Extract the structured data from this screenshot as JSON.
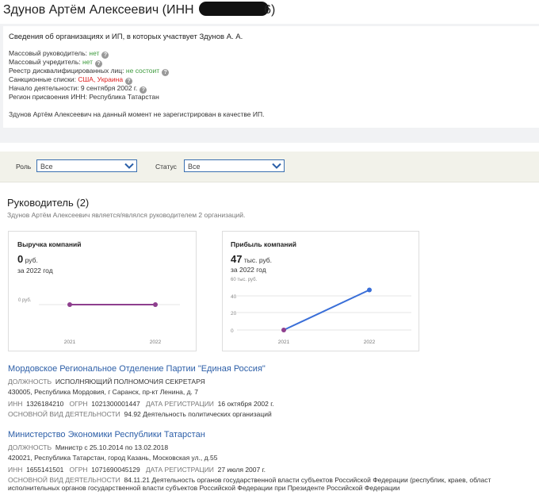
{
  "header": {
    "title_prefix": "Здунов Артём Алексеевич (ИНН ",
    "title_suffix": "6)"
  },
  "summary": {
    "intro": "Сведения об организациях и ИП, в которых участвует Здунов А. А.",
    "rows": [
      {
        "label": "Массовый руководитель:",
        "value": "нет",
        "value_color": "#3d9a3d"
      },
      {
        "label": "Массовый учредитель:",
        "value": "нет",
        "value_color": "#3d9a3d"
      },
      {
        "label": "Реестр дисквалифицированных лиц:",
        "value": "не состоит",
        "value_color": "#3d9a3d"
      },
      {
        "label": "Санкционные списки:",
        "value": "США, Украина",
        "value_color": "#dd2222"
      }
    ],
    "start_activity": "Начало деятельности: 9 сентября 2002 г.",
    "inn_region": "Регион присвоения ИНН: Республика Татарстан",
    "ip_note": "Здунов Артём Алексеевич на данный момент не зарегистрирован в качестве ИП."
  },
  "filters": {
    "role_label": "Роль",
    "role_value": "Все",
    "status_label": "Статус",
    "status_value": "Все"
  },
  "section": {
    "title": "Руководитель (2)",
    "subtitle": "Здунов Артём Алексеевич является/являлся руководителем 2 организаций."
  },
  "charts": {
    "revenue": {
      "title": "Выручка компаний",
      "value": "0",
      "unit": "руб.",
      "period": "за 2022 год"
    },
    "profit": {
      "title": "Прибыль компаний",
      "value": "47",
      "unit": "тыс. руб.",
      "period": "за 2022 год"
    }
  },
  "chart_data": [
    {
      "type": "line",
      "title": "Выручка компаний",
      "x": [
        "2021",
        "2022"
      ],
      "y": [
        0,
        0
      ],
      "ytick_labels": [
        "0 руб."
      ],
      "series_color": "#8e3f8e"
    },
    {
      "type": "line",
      "title": "Прибыль компаний",
      "x": [
        "2021",
        "2022"
      ],
      "y": [
        0,
        47
      ],
      "ylim": [
        0,
        60
      ],
      "yticks": [
        0,
        20,
        40
      ],
      "ytop_label": "60 тыс. руб.",
      "series_color": "#3a6fd8"
    }
  ],
  "orgs": [
    {
      "name": "Мордовское Региональное Отделение Партии \"Единая Россия\"",
      "position_label": "ДОЛЖНОСТЬ",
      "position": "ИСПОЛНЯЮЩИЙ ПОЛНОМОЧИЯ СЕКРЕТАРЯ",
      "address": "430005, Республика Мордовия, г Саранск, пр-кт Ленина, д. 7",
      "inn_label": "ИНН",
      "inn": "1326184210",
      "ogrn_label": "ОГРН",
      "ogrn": "1021300001447",
      "reg_label": "ДАТА РЕГИСТРАЦИИ",
      "reg": "16 октября 2002 г.",
      "activity_label": "ОСНОВНОЙ ВИД ДЕЯТЕЛЬНОСТИ",
      "activity": "94.92 Деятельность политических организаций"
    },
    {
      "name": "Министерство Экономики Республики Татарстан",
      "position_label": "ДОЛЖНОСТЬ",
      "position": "Министр с 25.10.2014 по 13.02.2018",
      "address": "420021, Республика Татарстан, город Казань, Московская ул., д.55",
      "inn_label": "ИНН",
      "inn": "1655141501",
      "ogrn_label": "ОГРН",
      "ogrn": "1071690045129",
      "reg_label": "ДАТА РЕГИСТРАЦИИ",
      "reg": "27 июля 2007 г.",
      "activity_label": "ОСНОВНОЙ ВИД ДЕЯТЕЛЬНОСТИ",
      "activity": "84.11.21 Деятельность органов государственной власти субъектов Российской Федерации (республик, краев, област",
      "activity_line2": "исполнительных органов государственной власти субъектов Российской Федерации при Президенте Российской Федерации"
    }
  ]
}
